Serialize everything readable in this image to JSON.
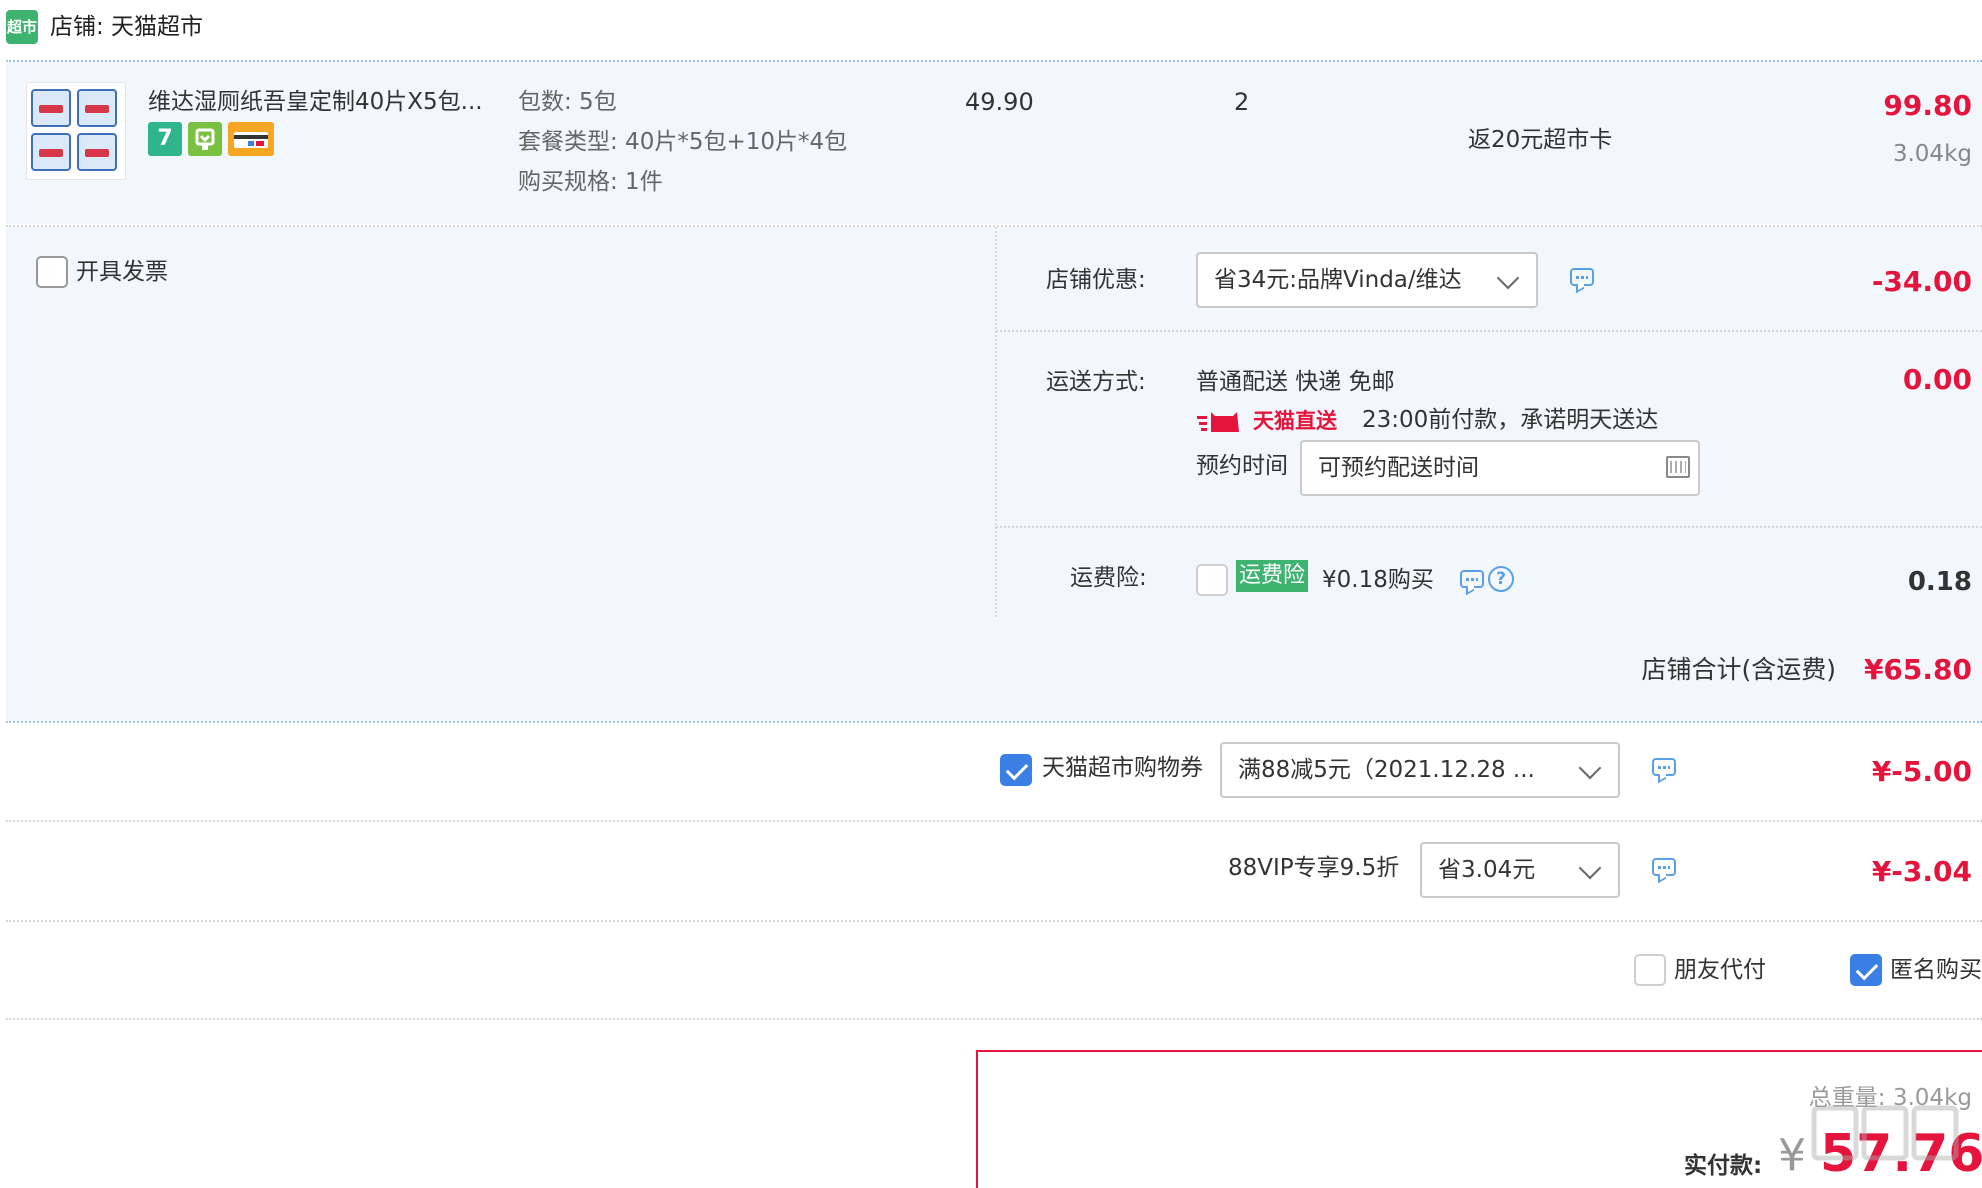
{
  "shop": {
    "icon_label": "超市",
    "name": "店铺: 天猫超市"
  },
  "item": {
    "title": "维达湿厕纸吾皇定制40片X5包...",
    "attrs": [
      "包数: 5包",
      "套餐类型: 40片*5包+10片*4包",
      "购买规格: 1件"
    ],
    "unit_price": "49.90",
    "quantity": "2",
    "rebate": "返20元超市卡",
    "subtotal": "99.80",
    "weight": "3.04kg",
    "badges": [
      {
        "icon": "seven-day-return-icon",
        "text": "7",
        "color": "#2fb58c"
      },
      {
        "icon": "shop-guarantee-icon",
        "text": "",
        "color": "#7ac142"
      },
      {
        "icon": "card-pay-icon",
        "text": "",
        "color": "#f5a623"
      }
    ]
  },
  "invoice": {
    "label": "开具发票",
    "checked": false
  },
  "shop_discount": {
    "label": "店铺优惠:",
    "selected": "省34元:品牌Vinda/维达",
    "amount": "-34.00"
  },
  "shipping": {
    "label": "运送方式:",
    "method": "普通配送 快递 免邮",
    "brand": "天猫直送",
    "promise": "23:00前付款，承诺明天送达",
    "schedule_label": "预约时间",
    "schedule_placeholder": "可预约配送时间",
    "amount": "0.00"
  },
  "insurance": {
    "label": "运费险:",
    "tag": "运费险",
    "price_text": "¥0.18购买",
    "help": "?",
    "amount": "0.18"
  },
  "shop_total": {
    "label": "店铺合计(含运费)",
    "amount": "¥65.80"
  },
  "coupon": {
    "label": "天猫超市购物券",
    "checked": true,
    "selected": "满88减5元（2021.12.28 ...",
    "amount": "¥-5.00"
  },
  "vip": {
    "label": "88VIP专享9.5折",
    "selected": "省3.04元",
    "amount": "¥-3.04"
  },
  "options": {
    "friend_pay": {
      "label": "朋友代付",
      "checked": false
    },
    "anonymous": {
      "label": "匿名购买",
      "checked": true
    }
  },
  "summary": {
    "weight_label": "总重量: 3.04kg",
    "pay_label": "实付款:",
    "currency": "¥",
    "pay_amount": "57.76"
  },
  "colors": {
    "accent_red": "#e4143c",
    "link_blue": "#3a7fe4",
    "brand_green": "#3eb370",
    "panel_bg": "#f2f7fd"
  }
}
